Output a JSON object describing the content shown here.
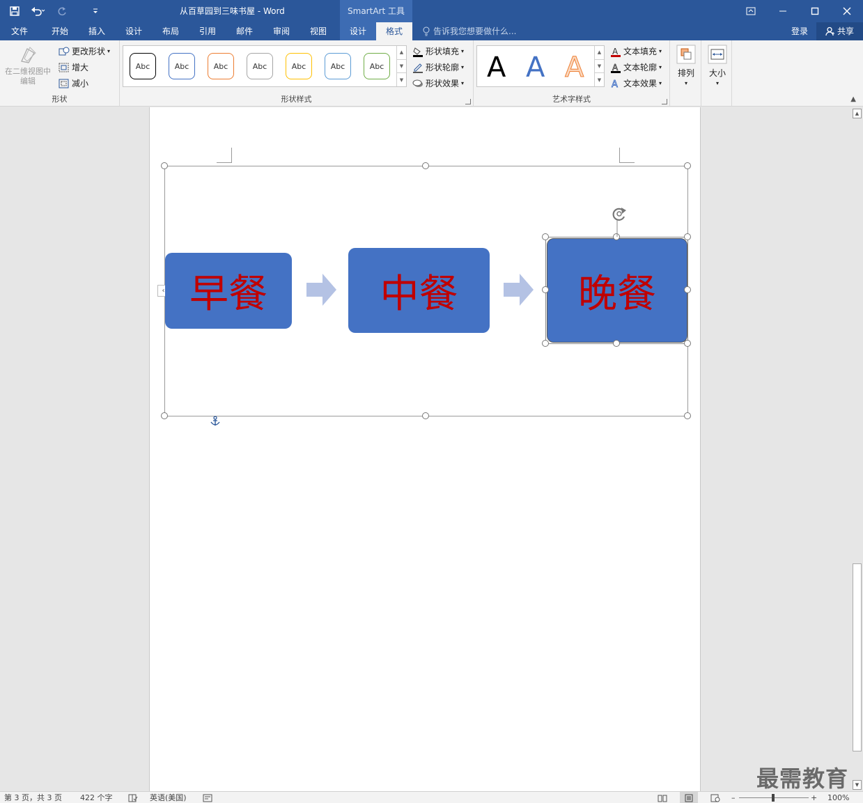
{
  "window": {
    "title": "从百草园到三味书屋 - Word",
    "context_tab_title": "SmartArt 工具"
  },
  "tabs": [
    {
      "label": "文件"
    },
    {
      "label": "开始"
    },
    {
      "label": "插入"
    },
    {
      "label": "设计"
    },
    {
      "label": "布局"
    },
    {
      "label": "引用"
    },
    {
      "label": "邮件"
    },
    {
      "label": "审阅"
    },
    {
      "label": "视图"
    },
    {
      "label": "设计"
    },
    {
      "label": "格式"
    }
  ],
  "tell_me": "告诉我您想要做什么...",
  "account": {
    "sign_in": "登录",
    "share": "共享"
  },
  "ribbon": {
    "shapes_group": {
      "label": "形状",
      "edit_2d": "在二维视图中编辑",
      "change_shape": "更改形状",
      "larger": "增大",
      "smaller": "减小"
    },
    "shape_styles_group": {
      "label": "形状样式",
      "swatch_text": "Abc",
      "swatch_colors": [
        "#000000",
        "#4472c4",
        "#ed7d31",
        "#a5a5a5",
        "#ffc000",
        "#5b9bd5",
        "#70ad47"
      ],
      "fill": "形状填充",
      "outline": "形状轮廓",
      "effects": "形状效果"
    },
    "wordart_group": {
      "label": "艺术字样式",
      "letter": "A",
      "letter_colors": [
        "#000000",
        "#4472c4",
        "#f4b183"
      ],
      "text_fill": "文本填充",
      "text_outline": "文本轮廓",
      "text_effects": "文本效果"
    },
    "arrange": "排列",
    "size": "大小"
  },
  "smartart": {
    "nodes": [
      {
        "text": "早餐"
      },
      {
        "text": "中餐"
      },
      {
        "text": "晚餐"
      }
    ],
    "node_color": "#4472c4",
    "text_color": "#c00000",
    "arrow_color": "#b4c2e4"
  },
  "status": {
    "page": "第 3 页，共 3 页",
    "words": "422 个字",
    "language": "英语(美国)",
    "zoom": "100%"
  },
  "watermark": "最需教育"
}
